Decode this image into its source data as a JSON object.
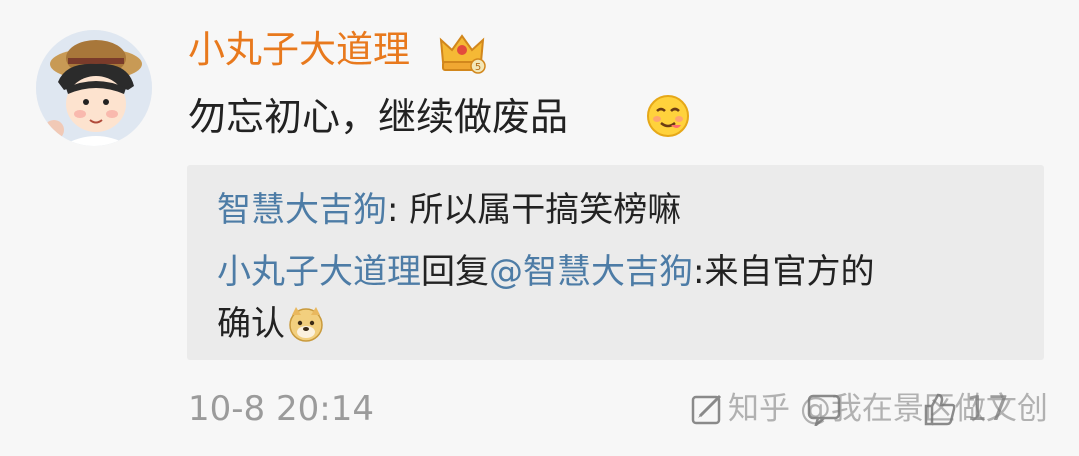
{
  "post": {
    "username": "小丸子大道理",
    "badge_icon": "crown-icon",
    "text": "勿忘初心，继续做废品",
    "text_emoji": "savoring-face-icon",
    "timestamp": "10-8 20:14"
  },
  "quote": {
    "line1_user": "智慧大吉狗",
    "line1_text": ": 所以属干搞笑榜嘛",
    "line2_user": "小丸子大道理",
    "line2_reply": "回复",
    "line2_mention": "@智慧大吉狗",
    "line2_text": ":来自官方的",
    "line3_text": "确认",
    "line3_emoji": "doge-icon"
  },
  "actions": {
    "repost_icon": "repost-icon",
    "comment_icon": "comment-icon",
    "like_icon": "like-icon",
    "like_count": "17"
  },
  "watermark": {
    "text": "知乎 @我在景区做文创"
  },
  "colors": {
    "username": "#e8791d",
    "link": "#4d7ca6",
    "quote_bg": "#ebebeb",
    "meta": "#9b9b9b"
  }
}
